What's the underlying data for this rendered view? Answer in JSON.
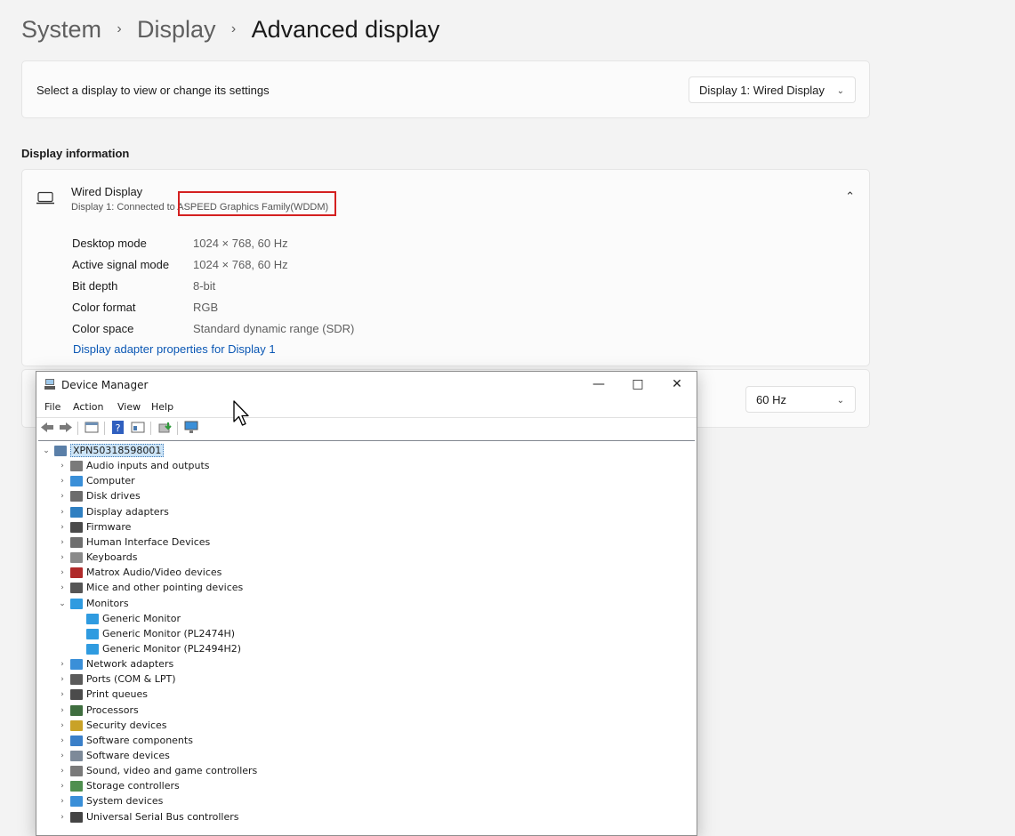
{
  "breadcrumb": [
    "System",
    "Display",
    "Advanced display"
  ],
  "breadcrumb_separator": "›",
  "select_display": {
    "label": "Select a display to view or change its settings",
    "value": "Display 1: Wired Display"
  },
  "display_info": {
    "heading": "Display information",
    "title": "Wired Display",
    "subtitle_prefix": "Display 1: Connected to ",
    "adapter": "ASPEED Graphics Family(WDDM)",
    "rows": [
      {
        "key": "Desktop mode",
        "value": "1024 × 768, 60 Hz"
      },
      {
        "key": "Active signal mode",
        "value": "1024 × 768, 60 Hz"
      },
      {
        "key": "Bit depth",
        "value": "8-bit"
      },
      {
        "key": "Color format",
        "value": "RGB"
      },
      {
        "key": "Color space",
        "value": "Standard dynamic range (SDR)"
      }
    ],
    "link": "Display adapter properties for Display 1",
    "highlight_color": "#d42020"
  },
  "refresh_rate": {
    "value": "60 Hz"
  },
  "device_manager": {
    "title": "Device Manager",
    "menu": [
      "File",
      "Action",
      "View",
      "Help"
    ],
    "root": "XPN50318598001",
    "tree": [
      {
        "label": "Audio inputs and outputs",
        "icon": "speaker-icon",
        "color": "#7a7a7a"
      },
      {
        "label": "Computer",
        "icon": "computer-icon",
        "color": "#3a8fd8"
      },
      {
        "label": "Disk drives",
        "icon": "disk-icon",
        "color": "#6c6c6c"
      },
      {
        "label": "Display adapters",
        "icon": "display-adapter-icon",
        "color": "#2f7fc1"
      },
      {
        "label": "Firmware",
        "icon": "firmware-icon",
        "color": "#4a4a4a"
      },
      {
        "label": "Human Interface Devices",
        "icon": "hid-icon",
        "color": "#6f6f6f"
      },
      {
        "label": "Keyboards",
        "icon": "keyboard-icon",
        "color": "#8a8a8a"
      },
      {
        "label": "Matrox Audio/Video devices",
        "icon": "matrox-icon",
        "color": "#b02a2a"
      },
      {
        "label": "Mice and other pointing devices",
        "icon": "mouse-icon",
        "color": "#555555"
      },
      {
        "label": "Monitors",
        "icon": "monitor-icon",
        "color": "#2f9be0",
        "expanded": true,
        "children": [
          "Generic Monitor",
          "Generic Monitor (PL2474H)",
          "Generic Monitor (PL2494H2)"
        ]
      },
      {
        "label": "Network adapters",
        "icon": "network-icon",
        "color": "#3a8fd8"
      },
      {
        "label": "Ports (COM & LPT)",
        "icon": "port-icon",
        "color": "#5a5a5a"
      },
      {
        "label": "Print queues",
        "icon": "printer-icon",
        "color": "#4b4b4b"
      },
      {
        "label": "Processors",
        "icon": "processor-icon",
        "color": "#3f6e3f"
      },
      {
        "label": "Security devices",
        "icon": "security-icon",
        "color": "#c9a227"
      },
      {
        "label": "Software components",
        "icon": "software-components-icon",
        "color": "#3a7fc8"
      },
      {
        "label": "Software devices",
        "icon": "software-devices-icon",
        "color": "#7d8a99"
      },
      {
        "label": "Sound, video and game controllers",
        "icon": "sound-icon",
        "color": "#7a7a7a"
      },
      {
        "label": "Storage controllers",
        "icon": "storage-icon",
        "color": "#4f8f4f"
      },
      {
        "label": "System devices",
        "icon": "system-devices-icon",
        "color": "#3a8fd8"
      },
      {
        "label": "Universal Serial Bus controllers",
        "icon": "usb-icon",
        "color": "#444444"
      }
    ]
  }
}
